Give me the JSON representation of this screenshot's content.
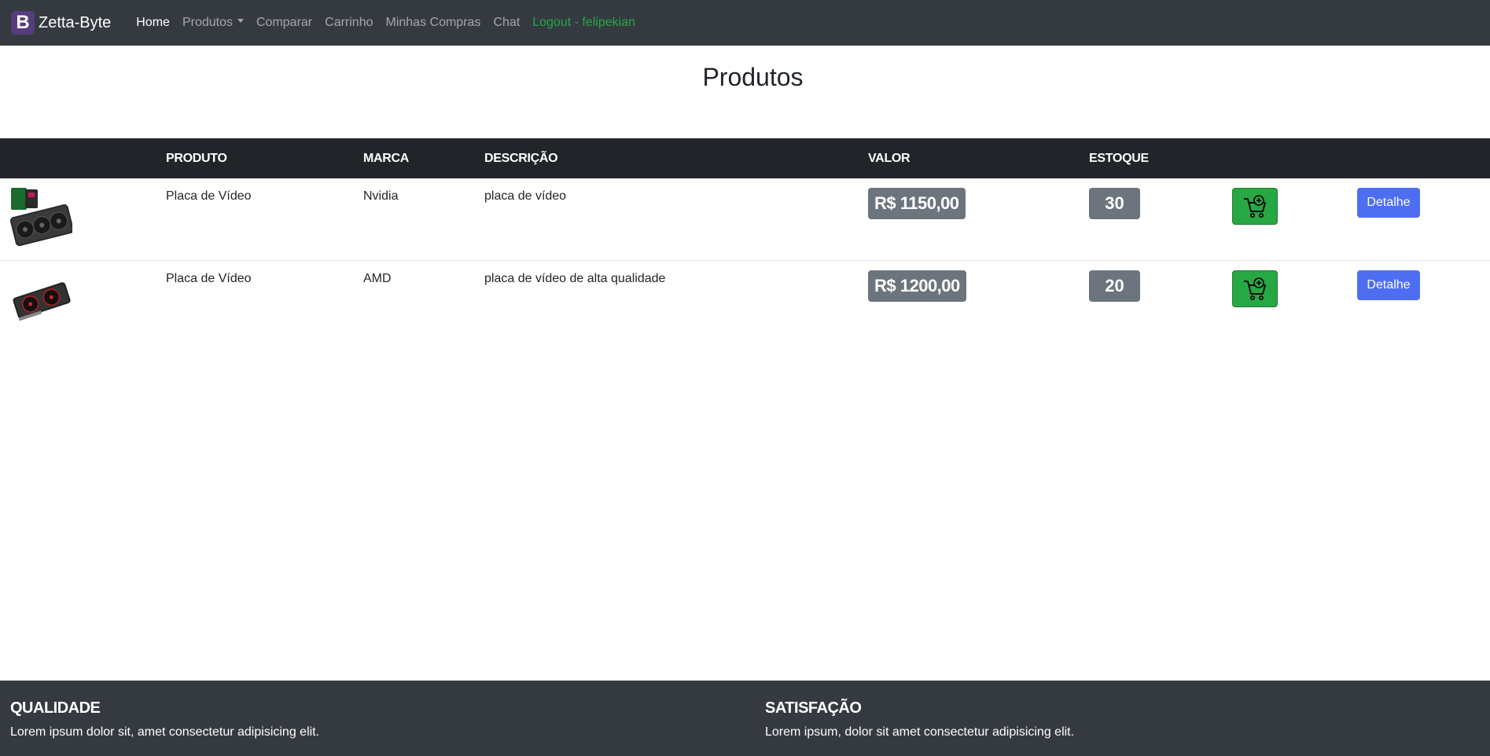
{
  "navbar": {
    "brand_logo": "B",
    "brand_name": "Zetta-Byte",
    "links": {
      "home": "Home",
      "produtos": "Produtos",
      "comparar": "Comparar",
      "carrinho": "Carrinho",
      "minhas_compras": "Minhas Compras",
      "chat": "Chat",
      "logout": "Logout - felipekian"
    },
    "colors": {
      "background": "#343a40",
      "logout": "#28a745",
      "logo": "#563d7c"
    }
  },
  "page": {
    "title": "Produtos"
  },
  "table": {
    "headers": [
      "PRODUTO",
      "MARCA",
      "DESCRIÇÃO",
      "VALOR",
      "ESTOQUE"
    ],
    "rows": [
      {
        "image": "graphics-card-rog-icon",
        "produto": "Placa de Vídeo",
        "marca": "Nvidia",
        "descricao": "placa de vídeo",
        "valor": "R$ 1150,00",
        "estoque": "30",
        "cart_icon": "cart-plus-icon",
        "detail_label": "Detalhe"
      },
      {
        "image": "graphics-card-amd-icon",
        "produto": "Placa de Vídeo",
        "marca": "AMD",
        "descricao": "placa de vídeo de alta qualidade",
        "valor": "R$ 1200,00",
        "estoque": "20",
        "cart_icon": "cart-plus-icon",
        "detail_label": "Detalhe"
      }
    ],
    "colors": {
      "header": "#212529",
      "badge": "#6c757d",
      "cart_button": "#28a745",
      "detail_button": "#4e6ef2"
    }
  },
  "footer": {
    "columns": [
      {
        "title": "QUALIDADE",
        "text": "Lorem ipsum dolor sit, amet consectetur adipisicing elit."
      },
      {
        "title": "SATISFAÇÃO",
        "text": "Lorem ipsum, dolor sit amet consectetur adipisicing elit."
      }
    ]
  }
}
